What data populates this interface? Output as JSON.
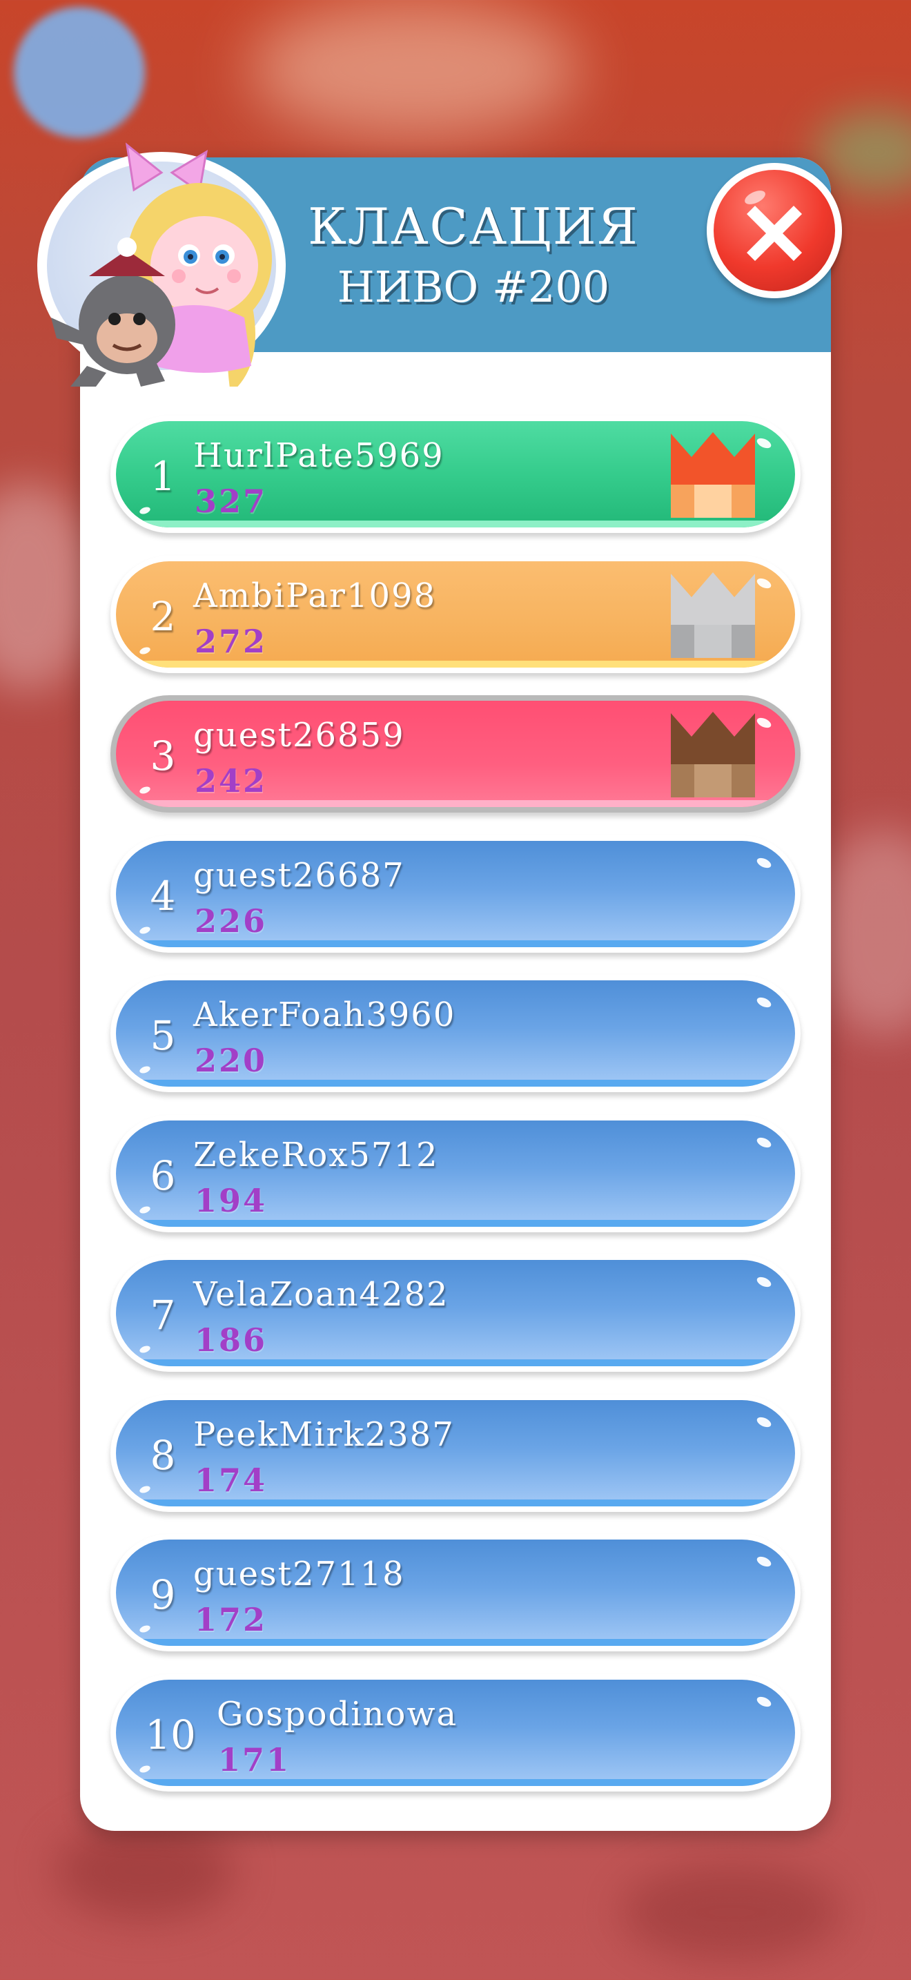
{
  "header": {
    "title": "КЛАСАЦИЯ",
    "subtitle": "НИВО #200"
  },
  "colors": {
    "header_bg": "#4d9ac4",
    "score_text": "#a23fc7",
    "first_place": "#35cc8c",
    "second_place": "#f7b35f",
    "third_place": "#ff5f80",
    "other_places": "#6aa4e6",
    "close_button": "#f0392c"
  },
  "icons": {
    "close": "close-x-icon",
    "avatar": "girl-with-monkey-avatar",
    "crowns": [
      "gold-crown-icon",
      "silver-crown-icon",
      "bronze-crown-icon"
    ]
  },
  "leaderboard": [
    {
      "rank": "1",
      "name": "HurlPate5969",
      "score": "327",
      "style": "green",
      "crown": "gold"
    },
    {
      "rank": "2",
      "name": "AmbiPar1098",
      "score": "272",
      "style": "orange",
      "crown": "silver"
    },
    {
      "rank": "3",
      "name": "guest26859",
      "score": "242",
      "style": "pink",
      "crown": "bronze"
    },
    {
      "rank": "4",
      "name": "guest26687",
      "score": "226",
      "style": "blue",
      "crown": null
    },
    {
      "rank": "5",
      "name": "AkerFoah3960",
      "score": "220",
      "style": "blue",
      "crown": null
    },
    {
      "rank": "6",
      "name": "ZekeRox5712",
      "score": "194",
      "style": "blue",
      "crown": null
    },
    {
      "rank": "7",
      "name": "VelaZoan4282",
      "score": "186",
      "style": "blue",
      "crown": null
    },
    {
      "rank": "8",
      "name": "PeekMirk2387",
      "score": "174",
      "style": "blue",
      "crown": null
    },
    {
      "rank": "9",
      "name": "guest27118",
      "score": "172",
      "style": "blue",
      "crown": null
    },
    {
      "rank": "10",
      "name": "Gospodinowa",
      "score": "171",
      "style": "blue",
      "crown": null
    }
  ]
}
